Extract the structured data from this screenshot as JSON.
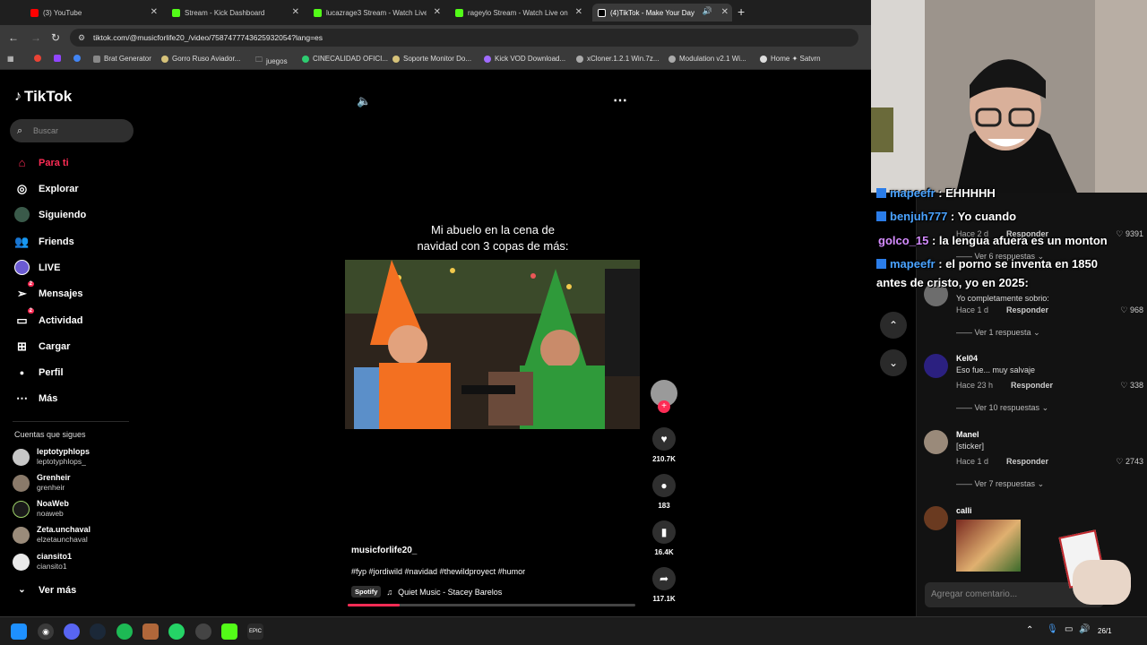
{
  "browser": {
    "tabs": [
      {
        "label": "(3) YouTube",
        "color": "#ff0000"
      },
      {
        "label": "Stream - Kick Dashboard",
        "color": "#53fc18"
      },
      {
        "label": "lucazrage3 Stream - Watch Live",
        "color": "#53fc18"
      },
      {
        "label": "rageylo Stream - Watch Live on",
        "color": "#53fc18"
      },
      {
        "label": "(4)TikTok - Make Your Day",
        "color": "#ffffff"
      }
    ],
    "url": "tiktok.com/@musicforlife20_/video/7587477743625932054?lang=es",
    "bookmarks": [
      "Brat Generator",
      "Gorro Ruso Aviador...",
      "juegos",
      "CINECALIDAD OFICI...",
      "Soporte Monitor Do...",
      "Kick VOD Download...",
      "xCloner.1.2.1 Win.7z...",
      "Modulation v2.1 Wi...",
      "Home ✦ Satvrn"
    ]
  },
  "sidebar": {
    "logo": "TikTok",
    "search_placeholder": "Buscar",
    "nav": [
      {
        "label": "Para ti",
        "icon": "home-icon",
        "active": true
      },
      {
        "label": "Explorar",
        "icon": "compass-icon"
      },
      {
        "label": "Siguiendo",
        "icon": "following-icon"
      },
      {
        "label": "Friends",
        "icon": "friends-icon"
      },
      {
        "label": "LIVE",
        "icon": "live-icon"
      },
      {
        "label": "Mensajes",
        "icon": "messages-icon",
        "badge": "2"
      },
      {
        "label": "Actividad",
        "icon": "activity-icon",
        "badge": "2"
      },
      {
        "label": "Cargar",
        "icon": "upload-icon"
      },
      {
        "label": "Perfil",
        "icon": "profile-icon"
      },
      {
        "label": "Más",
        "icon": "more-icon"
      }
    ],
    "following_title": "Cuentas que sigues",
    "accounts": [
      {
        "name": "leptotyphlops",
        "handle": "leptotyphlops_"
      },
      {
        "name": "Grenheir",
        "handle": "grenheir"
      },
      {
        "name": "NoaWeb",
        "handle": "noaweb"
      },
      {
        "name": "Zeta.unchaval",
        "handle": "elzetaunchaval"
      },
      {
        "name": "ciansito1",
        "handle": "ciansito1"
      }
    ],
    "see_more": "Ver más"
  },
  "video": {
    "caption_line1": "Mi abuelo en la cena de",
    "caption_line2": "navidad con 3 copas de más:",
    "author": "musicforlife20_",
    "hashtags": "#fyp #jordiwild #navidad #thewildproyect #humor",
    "spotify_label": "Spotify",
    "music": "Quiet Music - Stacey Barelos",
    "progress": 0.18,
    "likes": "210.7K",
    "comments": "183",
    "saves": "16.4K",
    "shares": "117.1K"
  },
  "comments": {
    "top_partial": {
      "time": "Hace 2 d",
      "reply": "Responder",
      "likes": "9391",
      "more": "Ver 6 respuestas"
    },
    "items": [
      {
        "user": "",
        "text": "Yo completamente sobrio:",
        "time": "Hace 1 d",
        "reply": "Responder",
        "likes": "968",
        "more": "Ver 1 respuesta"
      },
      {
        "user": "Kel04",
        "text": "Eso fue... muy salvaje",
        "time": "Hace 23 h",
        "reply": "Responder",
        "likes": "338",
        "more": "Ver 10 respuestas"
      },
      {
        "user": "Manel",
        "text": "[sticker]",
        "time": "Hace 1 d",
        "reply": "Responder",
        "likes": "2743",
        "more": "Ver 7 respuestas"
      },
      {
        "user": "calli",
        "text": "",
        "time": "",
        "reply": "",
        "likes": "",
        "more": ""
      }
    ],
    "add_placeholder": "Agregar comentario..."
  },
  "stream_chat": [
    {
      "user": "mapeefr",
      "user_color": "#4aa3ff",
      "msg": "EHHHHH"
    },
    {
      "user": "benjuh777",
      "user_color": "#4aa3ff",
      "msg": "Yo cuando"
    },
    {
      "user": "golco_15",
      "user_color": "#d58cff",
      "msg": "la lengua afuera es un monton"
    },
    {
      "user": "mapeefr",
      "user_color": "#4aa3ff",
      "msg": "el porno se inventa en 1850"
    },
    {
      "user": "",
      "user_color": "#ffffff",
      "msg": "antes de cristo, yo en 2025:"
    }
  ],
  "taskbar": {
    "date": "26/1"
  }
}
